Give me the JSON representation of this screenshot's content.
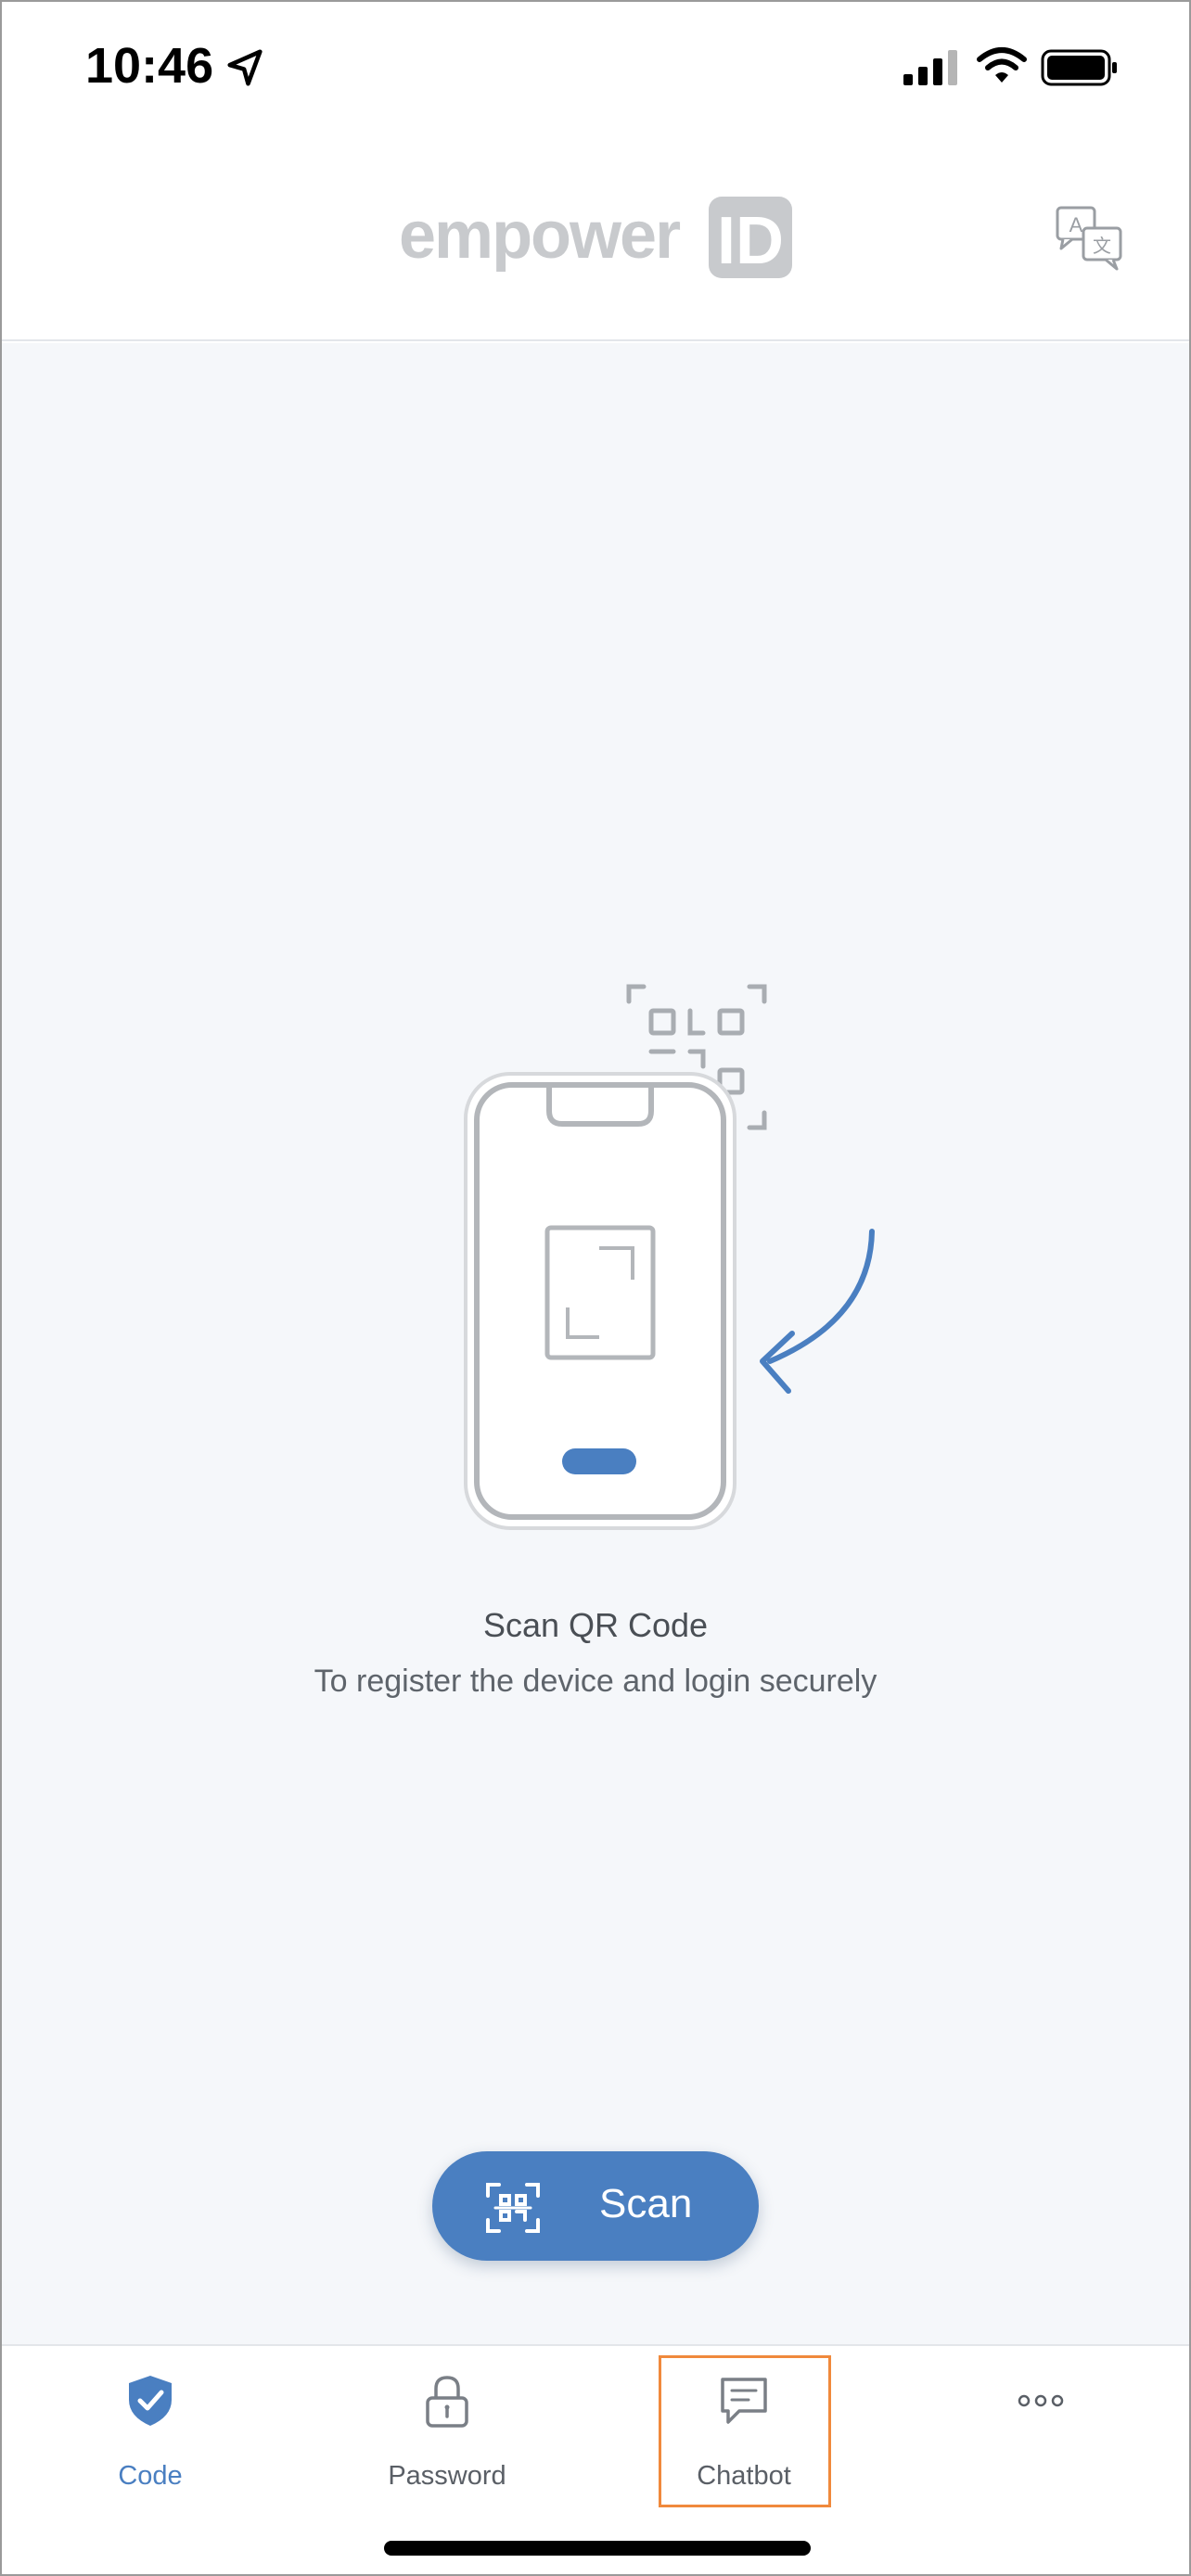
{
  "status_bar": {
    "time": "10:46"
  },
  "header": {
    "logo_text": "empower",
    "logo_mark": "ID",
    "translate_icon": "translate-icon"
  },
  "main": {
    "illustration_icon": "phone-scan-qr-illustration",
    "title": "Scan QR Code",
    "subtitle": "To register the device and login securely",
    "scan_button": {
      "label": "Scan",
      "icon": "qr-scan-icon"
    }
  },
  "tabbar": {
    "items": [
      {
        "label": "Code",
        "icon": "shield-check-icon",
        "active": true
      },
      {
        "label": "Password",
        "icon": "lock-icon",
        "active": false
      },
      {
        "label": "Chatbot",
        "icon": "chat-icon",
        "active": false
      },
      {
        "label": "",
        "icon": "more-icon",
        "active": false
      }
    ]
  },
  "colors": {
    "accent": "#4a7fc1",
    "background": "#f5f7fa",
    "highlight": "#f0893c",
    "logo_gray": "#c8cacd"
  }
}
